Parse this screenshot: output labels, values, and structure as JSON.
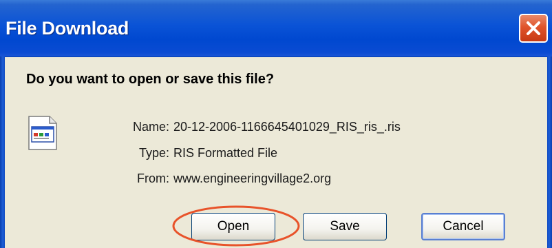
{
  "dialog": {
    "title": "File Download",
    "question": "Do you want to open or save this file?",
    "file": {
      "icon": "ris-file-icon",
      "name_label": "Name:",
      "name_value": "20-12-2006-1166645401029_RIS_ris_.ris",
      "type_label": "Type:",
      "type_value": "RIS Formatted File",
      "from_label": "From:",
      "from_value": "www.engineeringvillage2.org"
    },
    "buttons": {
      "open": "Open",
      "save": "Save",
      "cancel": "Cancel"
    },
    "colors": {
      "titlebar": "#0048d0",
      "close_button": "#e0542b",
      "highlight": "#e8532a",
      "background": "#ece9d8"
    }
  }
}
